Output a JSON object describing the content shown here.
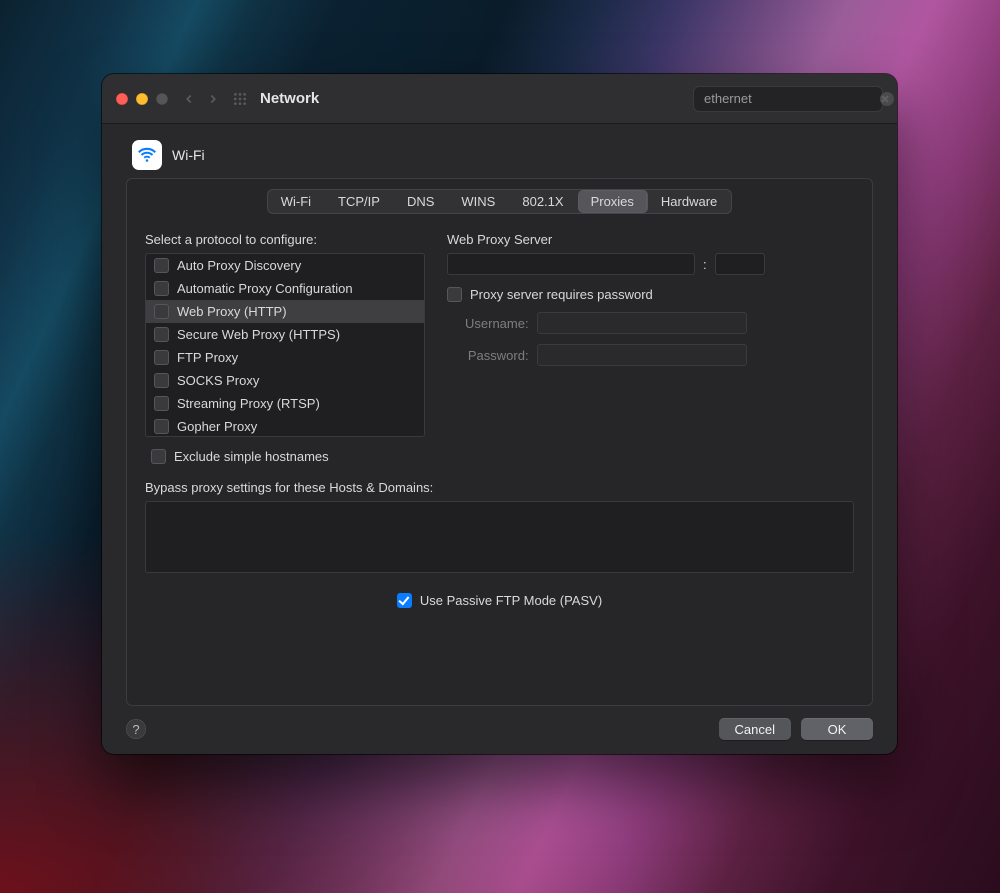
{
  "window": {
    "title": "Network",
    "search_value": "ethernet"
  },
  "interface": {
    "name": "Wi-Fi"
  },
  "tabs": [
    "Wi-Fi",
    "TCP/IP",
    "DNS",
    "WINS",
    "802.1X",
    "Proxies",
    "Hardware"
  ],
  "active_tab": "Proxies",
  "left": {
    "select_label": "Select a protocol to configure:",
    "protocols": [
      {
        "label": "Auto Proxy Discovery",
        "checked": false,
        "selected": false
      },
      {
        "label": "Automatic Proxy Configuration",
        "checked": false,
        "selected": false
      },
      {
        "label": "Web Proxy (HTTP)",
        "checked": false,
        "selected": true
      },
      {
        "label": "Secure Web Proxy (HTTPS)",
        "checked": false,
        "selected": false
      },
      {
        "label": "FTP Proxy",
        "checked": false,
        "selected": false
      },
      {
        "label": "SOCKS Proxy",
        "checked": false,
        "selected": false
      },
      {
        "label": "Streaming Proxy (RTSP)",
        "checked": false,
        "selected": false
      },
      {
        "label": "Gopher Proxy",
        "checked": false,
        "selected": false
      }
    ],
    "exclude_label": "Exclude simple hostnames",
    "exclude_checked": false
  },
  "right": {
    "server_label": "Web Proxy Server",
    "server_host": "",
    "server_port": "",
    "requires_password_label": "Proxy server requires password",
    "requires_password_checked": false,
    "username_label": "Username:",
    "username_value": "",
    "password_label": "Password:",
    "password_value": ""
  },
  "bypass": {
    "label": "Bypass proxy settings for these Hosts & Domains:",
    "value": ""
  },
  "pasv": {
    "label": "Use Passive FTP Mode (PASV)",
    "checked": true
  },
  "footer": {
    "cancel": "Cancel",
    "ok": "OK"
  }
}
